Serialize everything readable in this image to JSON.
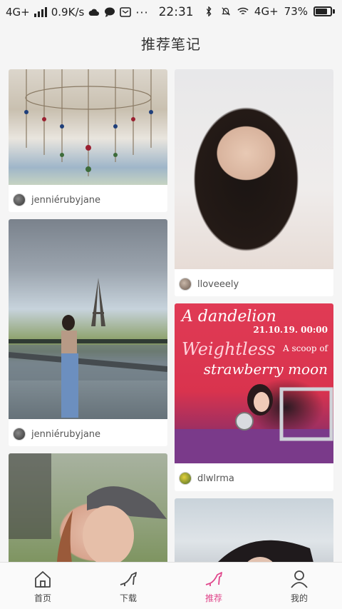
{
  "status_bar": {
    "network": "4G+",
    "speed": "0.9K/s",
    "time": "22:31",
    "right_network": "4G+",
    "battery": "73%",
    "battery_level": 0.73
  },
  "header": {
    "title": "推荐笔记"
  },
  "feed": {
    "cards": [
      {
        "author": "jenniérubyjane",
        "image": "chandelier-photo"
      },
      {
        "author": "lloveeely",
        "image": "portrait-photo"
      },
      {
        "author": "jenniérubyjane",
        "image": "eiffel-tower-photo"
      },
      {
        "author": "dlwlrma",
        "image": "dandelion-poster",
        "poster_lines": [
          "A dandelion",
          "21.10.19. 00:00",
          "Weightless",
          "A scoop of",
          "strawberry moon"
        ]
      },
      {
        "author": "",
        "image": "visor-selfie-photo"
      },
      {
        "author": "",
        "image": "mirror-photo"
      }
    ]
  },
  "bottom_nav": {
    "items": [
      {
        "label": "首页",
        "icon": "home-icon"
      },
      {
        "label": "下载",
        "icon": "heel-shoe-icon"
      },
      {
        "label": "推荐",
        "icon": "heel-shoe-icon",
        "active": true
      },
      {
        "label": "我的",
        "icon": "person-icon"
      }
    ],
    "accent_color": "#e0468b"
  }
}
